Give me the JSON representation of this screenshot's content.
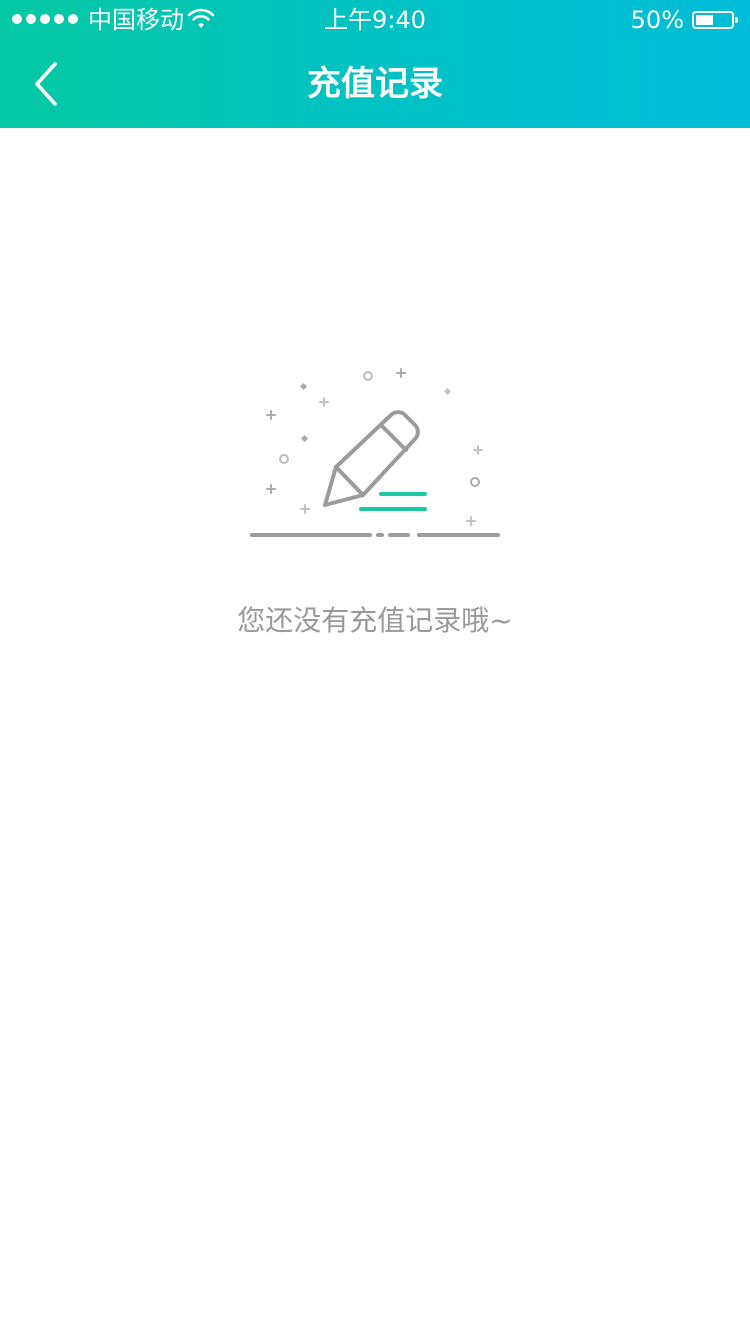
{
  "status_bar": {
    "carrier": "中国移动",
    "time": "上午9:40",
    "battery_percent_text": "50%",
    "battery_level": 0.5,
    "signal_bars": 5,
    "wifi_icon": "wifi-icon"
  },
  "nav": {
    "title": "充值记录",
    "back_icon": "chevron-left-icon"
  },
  "empty_state": {
    "illustration_icon": "pencil-writing-icon",
    "message": "您还没有充值记录哦~"
  },
  "colors": {
    "header_gradient_start": "#05c8a4",
    "header_gradient_end": "#00bcd8",
    "accent_green": "#1ec8a0",
    "illustration_gray": "#9b9b9b",
    "empty_text": "#999999",
    "background": "#ffffff"
  }
}
